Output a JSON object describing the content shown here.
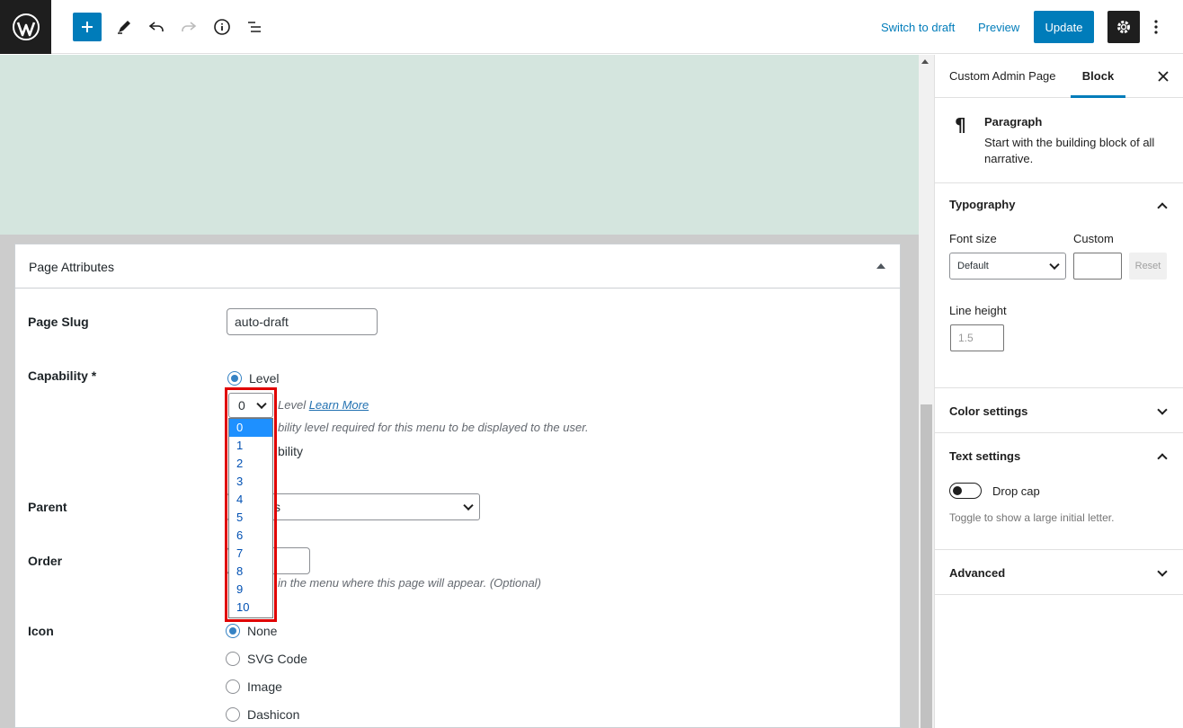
{
  "toolbar": {
    "logo_icon": "wordpress-logo-icon",
    "add_icon": "plus-icon",
    "tools_icon": "pencil-icon",
    "undo_icon": "undo-icon",
    "redo_icon": "redo-icon",
    "info_icon": "info-icon",
    "outline_icon": "list-view-icon",
    "switch_draft": "Switch to draft",
    "preview": "Preview",
    "update": "Update",
    "settings_icon": "gear-icon",
    "more_icon": "more-vertical-icon",
    "accent": "#007cba"
  },
  "editor": {
    "canvas_color": "#d4e5de"
  },
  "page_attributes": {
    "title": "Page Attributes",
    "slug_label": "Page Slug",
    "slug_value": "auto-draft",
    "capability_label": "Capability *",
    "level_label": "Level",
    "level_select_value": "0",
    "level_desc_visible": "Level",
    "learn_more": "Learn More",
    "level_help_visible": "bility level required for this menu to be displayed to the user.",
    "capability_option_visible": "bility",
    "parent_label": "Parent",
    "parent_value_visible": "s",
    "order_label": "Order",
    "order_help_visible": "in the menu where this page will appear. (Optional)",
    "icon_label": "Icon",
    "icon_options": [
      "None",
      "SVG Code",
      "Image",
      "Dashicon"
    ],
    "icon_selected": "None",
    "dropdown_options": [
      "0",
      "1",
      "2",
      "3",
      "4",
      "5",
      "6",
      "7",
      "8",
      "9",
      "10"
    ],
    "dropdown_selected": "0"
  },
  "sidebar": {
    "tab_document": "Custom Admin Page",
    "tab_block": "Block",
    "close_icon": "close-icon",
    "block_icon": "paragraph-icon",
    "block_name": "Paragraph",
    "block_desc": "Start with the building block of all narrative.",
    "typography": "Typography",
    "font_size_label": "Font size",
    "custom_label": "Custom",
    "font_size_value": "Default",
    "custom_value": "",
    "reset": "Reset",
    "line_height_label": "Line height",
    "line_height_placeholder": "1.5",
    "color_settings": "Color settings",
    "text_settings": "Text settings",
    "drop_cap": "Drop cap",
    "drop_cap_help": "Toggle to show a large initial letter.",
    "advanced": "Advanced"
  }
}
